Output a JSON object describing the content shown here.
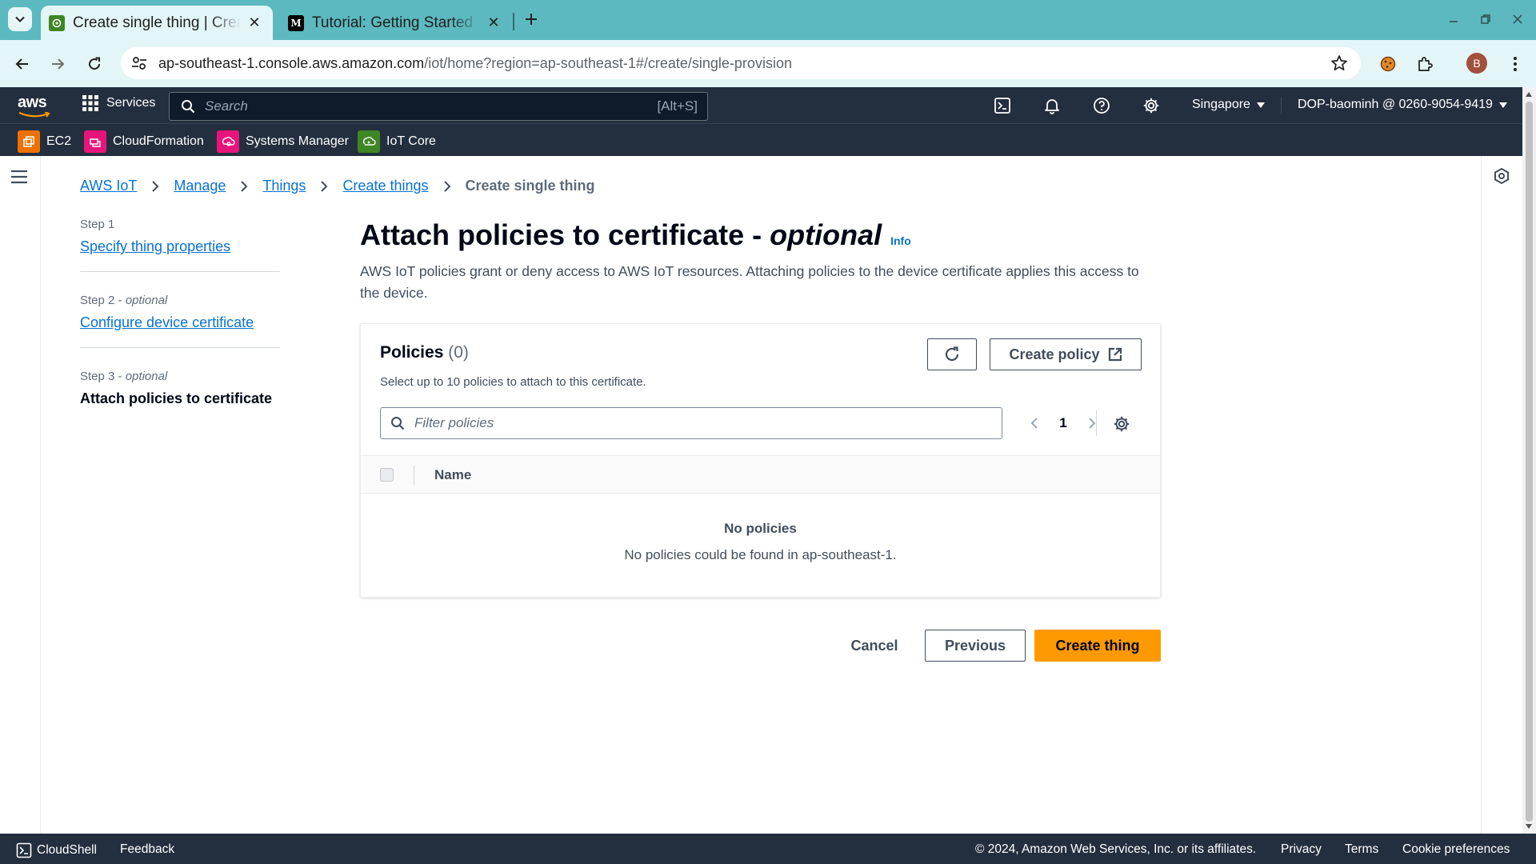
{
  "browser": {
    "tabs": [
      {
        "title": "Create single thing | Create things | AWS IoT",
        "active": true
      },
      {
        "title": "Tutorial: Getting Started",
        "active": false
      }
    ],
    "url_host": "ap-southeast-1.console.aws.amazon.com",
    "url_path": "/iot/home?region=ap-southeast-1#/create/single-provision",
    "profile_initial": "B"
  },
  "aws_header": {
    "logo": "aws",
    "services_label": "Services",
    "search_placeholder": "Search",
    "search_shortcut": "[Alt+S]",
    "region": "Singapore",
    "account": "DOP-baominh @ 0260-9054-9419"
  },
  "favorites": [
    {
      "label": "EC2",
      "color": "#ed7100"
    },
    {
      "label": "CloudFormation",
      "color": "#e7157b"
    },
    {
      "label": "Systems Manager",
      "color": "#e7157b"
    },
    {
      "label": "IoT Core",
      "color": "#3f8624"
    }
  ],
  "breadcrumb": {
    "items": [
      "AWS IoT",
      "Manage",
      "Things",
      "Create things"
    ],
    "current": "Create single thing"
  },
  "steps": [
    {
      "num": "Step 1",
      "optional": "",
      "label": "Specify thing properties"
    },
    {
      "num": "Step 2",
      "optional": "optional",
      "label": "Configure device certificate"
    },
    {
      "num": "Step 3",
      "optional": "optional",
      "label": "Attach policies to certificate"
    }
  ],
  "page": {
    "title_main": "Attach policies to certificate - ",
    "title_optional": "optional",
    "info": "Info",
    "description": "AWS IoT policies grant or deny access to AWS IoT resources. Attaching policies to the device certificate applies this access to the device."
  },
  "policies": {
    "title": "Policies",
    "count": "(0)",
    "subtitle": "Select up to 10 policies to attach to this certificate.",
    "create_policy_label": "Create policy",
    "filter_placeholder": "Filter policies",
    "page_number": "1",
    "column_name": "Name",
    "empty_title": "No policies",
    "empty_desc": "No policies could be found in ap-southeast-1."
  },
  "actions": {
    "cancel": "Cancel",
    "previous": "Previous",
    "create": "Create thing"
  },
  "footer": {
    "cloudshell": "CloudShell",
    "feedback": "Feedback",
    "copyright": "© 2024, Amazon Web Services, Inc. or its affiliates.",
    "privacy": "Privacy",
    "terms": "Terms",
    "cookies": "Cookie preferences"
  },
  "colors": {
    "accent_link": "#0972d3",
    "primary_button": "#ff9900",
    "aws_nav": "#232f3e",
    "browser_frame": "#5cb9bf"
  }
}
